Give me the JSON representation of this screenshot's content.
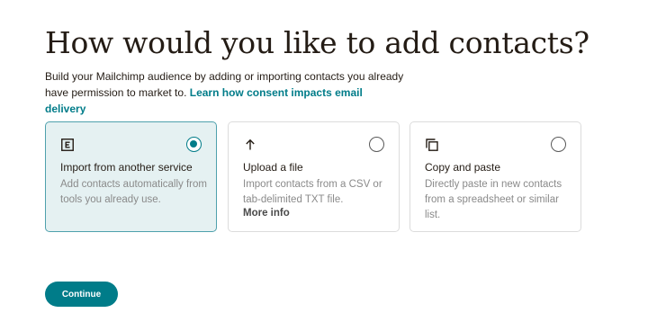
{
  "page": {
    "heading": "How would you like to add contacts?",
    "intro_text": "Build your Mailchimp audience by adding or importing contacts you already have permission to market to. ",
    "intro_link": "Learn how consent impacts email delivery"
  },
  "options": [
    {
      "icon": "import-service-icon",
      "title": "Import from another service",
      "description": "Add contacts automatically from tools you already use.",
      "selected": true
    },
    {
      "icon": "upload-arrow-icon",
      "title": "Upload a file",
      "description": "Import contacts from a CSV or tab-delimited TXT file.",
      "link": "More info",
      "selected": false
    },
    {
      "icon": "copy-icon",
      "title": "Copy and paste",
      "description": "Directly paste in new contacts from a spreadsheet or similar list.",
      "selected": false
    }
  ],
  "actions": {
    "continue_label": "Continue"
  },
  "colors": {
    "accent": "#007c89",
    "selected_card_bg": "#e5f1f2",
    "selected_card_border": "#4fa1ad",
    "text": "#241c15",
    "muted_text": "#8a8a8a"
  }
}
